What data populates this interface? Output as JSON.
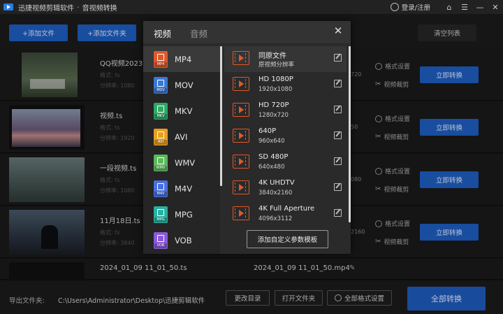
{
  "titlebar": {
    "app_name": "迅捷视频剪辑软件",
    "separator": "-",
    "section": "音视频转换",
    "login": "登录/注册",
    "icons": [
      "user-icon",
      "home-icon",
      "menu-icon",
      "minimize-icon",
      "close-icon"
    ]
  },
  "toolbar": {
    "add_file": "+添加文件",
    "add_folder": "+添加文件夹",
    "clear_list": "清空列表"
  },
  "files": [
    {
      "name": "QQ视频2023",
      "info1": "格式: ts",
      "info2": "分辨率: 1080",
      "res_tail": "720",
      "format_settings": "格式设置",
      "video_cut": "视频裁剪",
      "convert": "立即转换"
    },
    {
      "name": "视频.ts",
      "info1": "格式: ts",
      "info2": "分辨率: 1920",
      "res_tail": "50",
      "format_settings": "格式设置",
      "video_cut": "视频裁剪",
      "convert": "立即转换"
    },
    {
      "name": "一段视频.ts",
      "info1": "格式: ts",
      "info2": "分辨率: 1080",
      "res_tail": "080",
      "format_settings": "格式设置",
      "video_cut": "视频裁剪",
      "convert": "立即转换"
    },
    {
      "name": "11月18日.ts",
      "info1": "格式: ts",
      "info2": "分辨率: 3840",
      "res_tail": "2160",
      "format_settings": "格式设置",
      "video_cut": "视频裁剪",
      "convert": "立即转换"
    },
    {
      "name": "2024_01_09 11_01_50.ts",
      "output_name": "2024_01_09 11_01_50.mp4"
    }
  ],
  "popup": {
    "tab_video": "视频",
    "tab_audio": "音频",
    "formats": [
      {
        "label": "MP4",
        "tag": "MP4",
        "color": "#e0582a",
        "selected": true
      },
      {
        "label": "MOV",
        "tag": "MOV",
        "color": "#3a78d8",
        "selected": false
      },
      {
        "label": "MKV",
        "tag": "MKV",
        "color": "#2fa866",
        "selected": false
      },
      {
        "label": "AVI",
        "tag": "AVI",
        "color": "#e8a020",
        "selected": false
      },
      {
        "label": "WMV",
        "tag": "WMV",
        "color": "#5cb85c",
        "selected": false
      },
      {
        "label": "M4V",
        "tag": "M4V",
        "color": "#4a6fe0",
        "selected": false
      },
      {
        "label": "MPG",
        "tag": "MPG",
        "color": "#2ab0a0",
        "selected": false
      },
      {
        "label": "VOB",
        "tag": "VOB",
        "color": "#8a5ad8",
        "selected": false
      }
    ],
    "resolutions": [
      {
        "name": "同原文件",
        "size": "原视频分辨率",
        "selected": true
      },
      {
        "name": "HD 1080P",
        "size": "1920x1080",
        "selected": false
      },
      {
        "name": "HD 720P",
        "size": "1280x720",
        "selected": false
      },
      {
        "name": "640P",
        "size": "960x640",
        "selected": false
      },
      {
        "name": "SD 480P",
        "size": "640x480",
        "selected": false
      },
      {
        "name": "4K UHDTV",
        "size": "3840x2160",
        "selected": false
      },
      {
        "name": "4K Full Aperture",
        "size": "4096x3112",
        "selected": false
      }
    ],
    "custom_template": "添加自定义参数模板"
  },
  "bottom": {
    "output_label": "导出文件夹:",
    "output_path": "C:\\Users\\Administrator\\Desktop\\迅捷剪辑软件",
    "change_dir": "更改目录",
    "open_folder": "打开文件夹",
    "all_format_settings": "全部格式设置",
    "convert_all": "全部转换"
  },
  "colors": {
    "accent_blue": "#1e5fc4",
    "film_orange": "#e0582a"
  }
}
